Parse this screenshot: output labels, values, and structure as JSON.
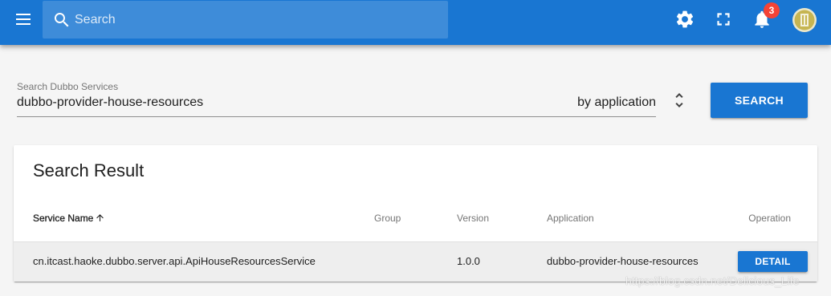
{
  "theme": {
    "primary": "#1976d2",
    "search_field_bg": "#3e8cd9",
    "badge": "#f44336",
    "row_hover": "#eeeeee",
    "background": "#f5f5f5"
  },
  "header": {
    "menu_icon": "menu-icon",
    "search_icon": "search-icon",
    "search_placeholder": "Search",
    "actions": [
      {
        "icon": "gear-icon"
      },
      {
        "icon": "fullscreen-icon"
      },
      {
        "icon": "bell-icon"
      }
    ],
    "notification_count": "3"
  },
  "search": {
    "label": "Search Dubbo Services",
    "value": "dubbo-provider-house-resources",
    "filter": "by application",
    "filter_icon": "unfold-more-icon",
    "button_label": "SEARCH"
  },
  "results": {
    "title": "Search Result",
    "columns": [
      {
        "label": "Service Name",
        "sort_icon": "arrow-up-icon"
      },
      {
        "label": "Group"
      },
      {
        "label": "Version"
      },
      {
        "label": "Application"
      },
      {
        "label": "Operation"
      }
    ],
    "rows": [
      {
        "service_name": "cn.itcast.haoke.dubbo.server.api.ApiHouseResourcesService",
        "group": "",
        "version": "1.0.0",
        "application": "dubbo-provider-house-resources",
        "action_label": "DETAIL"
      }
    ]
  },
  "watermark": "https://blog.csdn.net/Delicious_Life"
}
